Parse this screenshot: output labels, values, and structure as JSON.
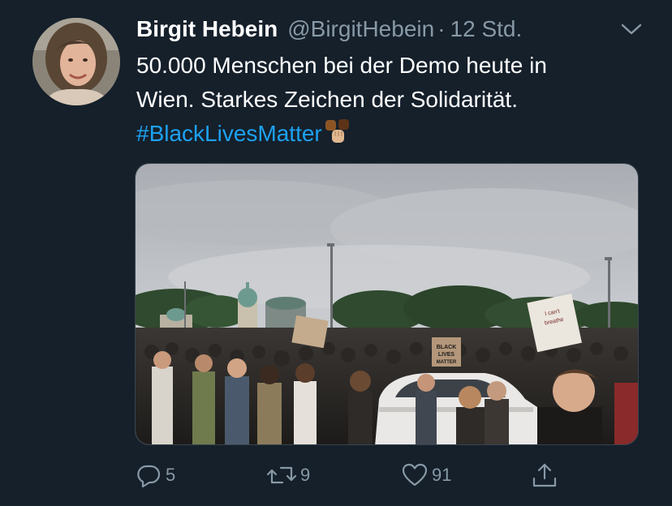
{
  "author": {
    "display_name": "Birgit Hebein",
    "handle": "@BirgitHebein",
    "separator": "·",
    "time": "12 Std."
  },
  "tweet": {
    "line1": "50.000 Menschen bei der Demo heute in",
    "line2": "Wien. Starkes Zeichen der Solidarität.",
    "hashtag": "#BlackLivesMatter",
    "emoji": "raised-fist-skin-tones"
  },
  "media": {
    "sign_text": "BLACK LIVES MATTER",
    "sign2_text": "I can't breathe"
  },
  "actions": {
    "replies": "5",
    "retweets": "9",
    "likes": "91"
  },
  "icons": {
    "reply": "reply-icon",
    "retweet": "retweet-icon",
    "like": "heart-icon",
    "share": "share-icon",
    "caret": "chevron-down-icon"
  },
  "colors": {
    "background": "#15202b",
    "secondary_text": "#8899a6",
    "link": "#1da1f2"
  }
}
